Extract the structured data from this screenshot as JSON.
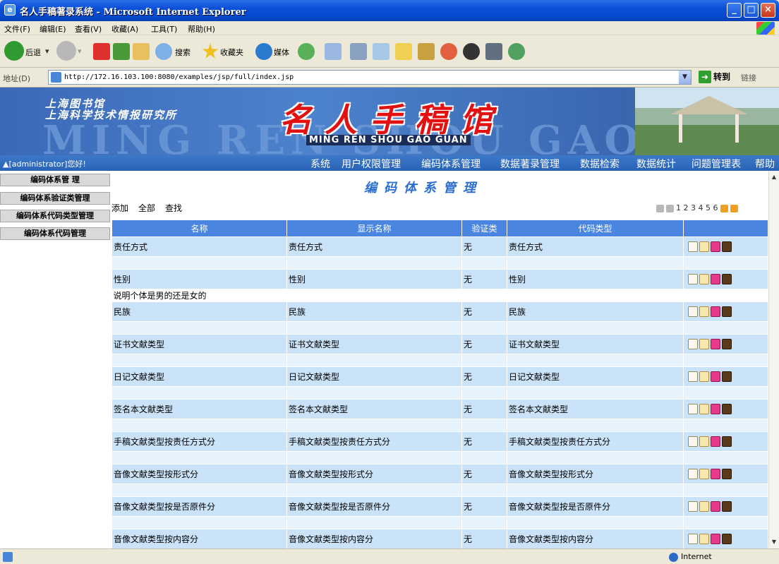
{
  "window": {
    "title": "名人手稿著录系统 - Microsoft Internet Explorer"
  },
  "menu": [
    "文件(F)",
    "编辑(E)",
    "查看(V)",
    "收藏(A)",
    "工具(T)",
    "帮助(H)"
  ],
  "toolbar": {
    "back": "后退",
    "search": "搜索",
    "favorites": "收藏夹",
    "media": "媒体"
  },
  "address": {
    "label": "地址(D)",
    "url": "http://172.16.103.100:8080/examples/jsp/full/index.jsp",
    "go": "转到",
    "links": "链接"
  },
  "banner": {
    "inst1": "上海图书馆",
    "inst2": "上海科学技术情报研究所",
    "title": "名人手稿馆",
    "pinyin": "MING REN SHOU GAO GUAN",
    "bg": "MING REN SHOU GAO GU"
  },
  "nav": {
    "user": "▲[administrator]您好!",
    "items": [
      "系统",
      "用户权限管理",
      "编码体系管理",
      "数据著录管理",
      "数据检索",
      "数据统计",
      "问题管理表",
      "帮助"
    ]
  },
  "sidebar": [
    "编码体系管 理",
    "编码体系验证类管理",
    "编码体系代码类型管理",
    "编码体系代码管理"
  ],
  "content": {
    "heading": "编码体系管理",
    "actions": [
      "添加",
      "全部",
      "查找"
    ],
    "pages": "1 2 3 4 5 6",
    "columns": [
      "名称",
      "显示名称",
      "验证类",
      "代码类型",
      ""
    ],
    "rows": [
      {
        "name": "责任方式",
        "display": "责任方式",
        "valid": "无",
        "code": "责任方式"
      },
      {
        "name": "性别",
        "display": "性别",
        "valid": "无",
        "code": "性别",
        "note": "说明个体是男的还是女的"
      },
      {
        "name": "民族",
        "display": "民族",
        "valid": "无",
        "code": "民族"
      },
      {
        "name": "证书文献类型",
        "display": "证书文献类型",
        "valid": "无",
        "code": "证书文献类型"
      },
      {
        "name": "日记文献类型",
        "display": "日记文献类型",
        "valid": "无",
        "code": "日记文献类型"
      },
      {
        "name": "签名本文献类型",
        "display": "签名本文献类型",
        "valid": "无",
        "code": "签名本文献类型"
      },
      {
        "name": "手稿文献类型按责任方式分",
        "display": "手稿文献类型按责任方式分",
        "valid": "无",
        "code": "手稿文献类型按责任方式分"
      },
      {
        "name": "音像文献类型按形式分",
        "display": "音像文献类型按形式分",
        "valid": "无",
        "code": "音像文献类型按形式分"
      },
      {
        "name": "音像文献类型按是否原件分",
        "display": "音像文献类型按是否原件分",
        "valid": "无",
        "code": "音像文献类型按是否原件分"
      },
      {
        "name": "音像文献类型按内容分",
        "display": "音像文献类型按内容分",
        "valid": "无",
        "code": "音像文献类型按内容分"
      }
    ]
  },
  "status": {
    "zone": "Internet"
  },
  "colors": {
    "title_bar": "#0a4fd8",
    "nav_bar": "#2a63b6",
    "table_header": "#4a86e0",
    "table_cell": "#cbe3f8",
    "banner_title": "#e21010"
  }
}
